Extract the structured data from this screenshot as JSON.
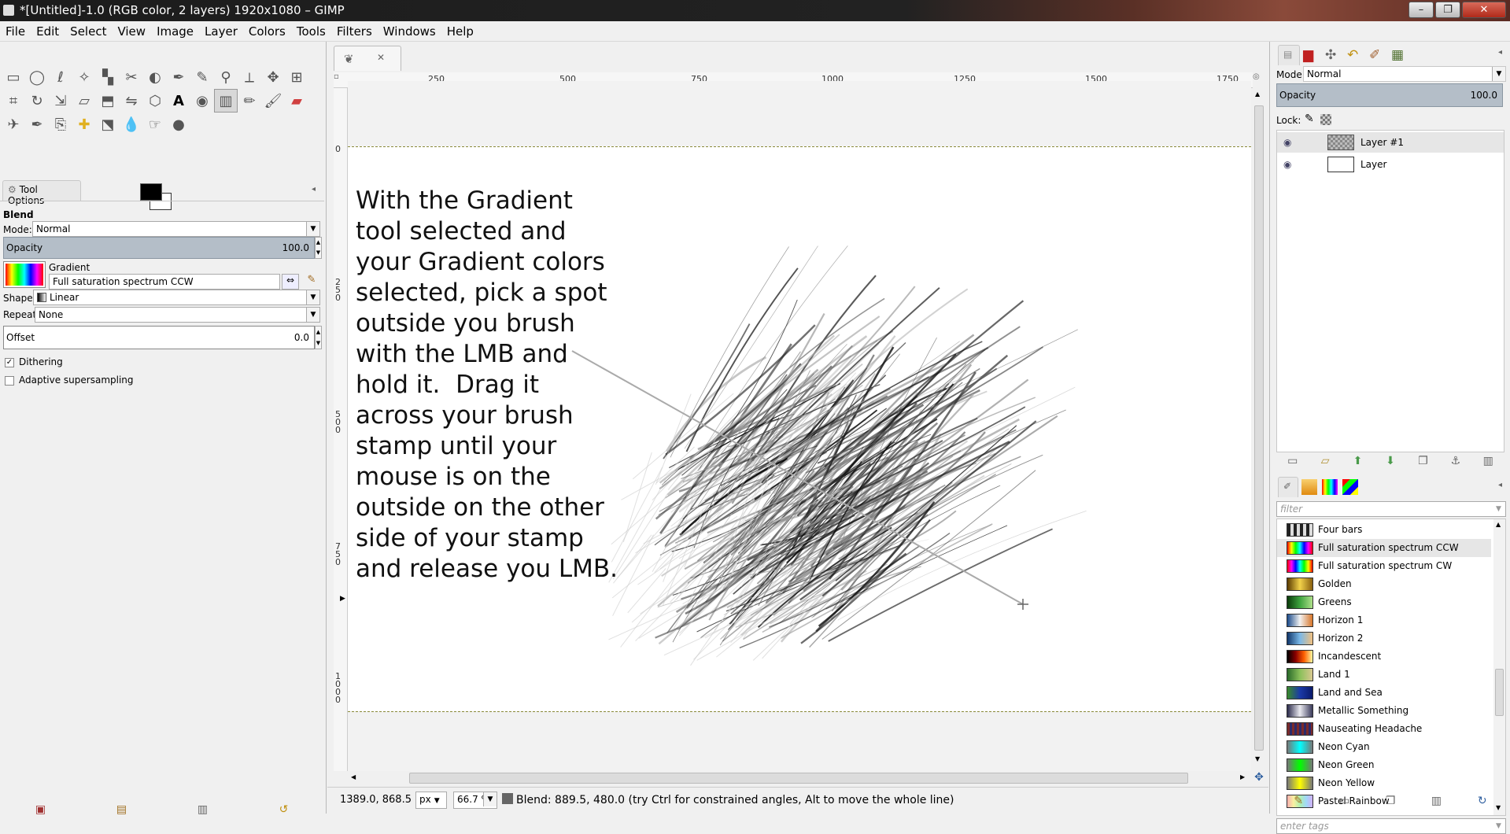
{
  "window": {
    "title": "*[Untitled]-1.0 (RGB color, 2 layers) 1920x1080 – GIMP",
    "min": "–",
    "max": "❐",
    "close": "✕"
  },
  "menu": [
    "File",
    "Edit",
    "Select",
    "View",
    "Image",
    "Layer",
    "Colors",
    "Tools",
    "Filters",
    "Windows",
    "Help"
  ],
  "toolbox": {
    "tools": [
      "rect-select",
      "ellipse-select",
      "free-select",
      "fuzzy-select",
      "color-select",
      "scissors",
      "foreground-select",
      "paths",
      "color-picker",
      "zoom",
      "measure",
      "move",
      "align",
      "crop",
      "rotate",
      "scale",
      "shear",
      "perspective",
      "flip",
      "cage",
      "text",
      "bucket-fill",
      "blend",
      "pencil",
      "paintbrush",
      "eraser",
      "airbrush",
      "ink",
      "clone",
      "heal",
      "perspective-clone",
      "blur",
      "smudge",
      "dodge-burn"
    ],
    "fg_color": "#000000",
    "bg_color": "#ffffff"
  },
  "tool_options": {
    "tab": "Tool Options",
    "tool_name": "Blend",
    "mode_label": "Mode:",
    "mode_value": "Normal",
    "opacity_label": "Opacity",
    "opacity_value": "100.0",
    "gradient_label": "Gradient",
    "gradient_value": "Full saturation spectrum CCW",
    "shape_label": "Shape:",
    "shape_value": "Linear",
    "repeat_label": "Repeat:",
    "repeat_value": "None",
    "offset_label": "Offset",
    "offset_value": "0.0",
    "dithering_label": "Dithering",
    "dithering_checked": true,
    "adaptive_label": "Adaptive supersampling",
    "adaptive_checked": false
  },
  "rulers": {
    "top": [
      "250",
      "500",
      "750",
      "1000",
      "1250",
      "1500",
      "1750"
    ],
    "left": [
      "0",
      "250",
      "500",
      "750",
      "1000"
    ]
  },
  "canvas": {
    "instructions": [
      "With the Gradient",
      "tool selected and",
      "your Gradient colors",
      "selected, pick a spot",
      "outside you brush",
      "with the LMB and",
      "hold it.  Drag it",
      "across your brush",
      "stamp until your",
      "mouse is on the",
      "outside on the other",
      "side of your stamp",
      "and release you LMB."
    ]
  },
  "status": {
    "coords": "1389.0, 868.5",
    "unit": "px",
    "zoom": "66.7 %",
    "message": "Blend: 889.5, 480.0 (try Ctrl for constrained angles, Alt to move the whole line)"
  },
  "layers": {
    "mode_label": "Mode:",
    "mode_value": "Normal",
    "opacity_label": "Opacity",
    "opacity_value": "100.0",
    "lock_label": "Lock:",
    "items": [
      {
        "name": "Layer #1"
      },
      {
        "name": "Layer"
      }
    ]
  },
  "gradients": {
    "filter_placeholder": "filter",
    "tags_placeholder": "enter tags",
    "selected": "Full saturation spectrum CCW",
    "items": [
      {
        "name": "Four bars",
        "css": "repeating-linear-gradient(90deg,#222 0 4px,#ddd 4px 8px)"
      },
      {
        "name": "Full saturation spectrum CCW",
        "css": "linear-gradient(90deg,#f00,#ff0,#0f0,#0ff,#00f,#f0f,#f00)"
      },
      {
        "name": "Full saturation spectrum CW",
        "css": "linear-gradient(90deg,#f00,#f0f,#00f,#0ff,#0f0,#ff0,#f00)"
      },
      {
        "name": "Golden",
        "css": "linear-gradient(90deg,#5a3a00,#f2d24a,#8a6010)"
      },
      {
        "name": "Greens",
        "css": "linear-gradient(90deg,#0a3a0a,#3ea43e,#aee08a)"
      },
      {
        "name": "Horizon 1",
        "css": "linear-gradient(90deg,#1a4a8a,#f2f2f2,#d8762a)"
      },
      {
        "name": "Horizon 2",
        "css": "linear-gradient(90deg,#10366a,#7ab8e8,#f0c080)"
      },
      {
        "name": "Incandescent",
        "css": "linear-gradient(90deg,#000,#8a0000,#ff6000,#fff8a0)"
      },
      {
        "name": "Land 1",
        "css": "linear-gradient(90deg,#2a6a2a,#8ac05a,#d8c890)"
      },
      {
        "name": "Land and Sea",
        "css": "linear-gradient(90deg,#3a8a2a,#1a3aa8,#0a1a6a)"
      },
      {
        "name": "Metallic Something",
        "css": "linear-gradient(90deg,#2a2a4a,#eaeaf0,#3a3a5a)"
      },
      {
        "name": "Nauseating Headache",
        "css": "repeating-linear-gradient(90deg,#7a2a2a 0 3px,#2a2a6a 3px 6px)"
      },
      {
        "name": "Neon Cyan",
        "css": "linear-gradient(90deg,#777 0%,#0ff 50%,#777 100%)"
      },
      {
        "name": "Neon Green",
        "css": "linear-gradient(90deg,#777 0%,#0f0 50%,#777 100%)"
      },
      {
        "name": "Neon Yellow",
        "css": "linear-gradient(90deg,#777 0%,#ff0 50%,#777 100%)"
      },
      {
        "name": "Pastel Rainbow",
        "css": "linear-gradient(90deg,#f8b0b0,#f8f0a0,#b0f0b0,#a0d8f8,#d0b0f8)"
      }
    ]
  }
}
